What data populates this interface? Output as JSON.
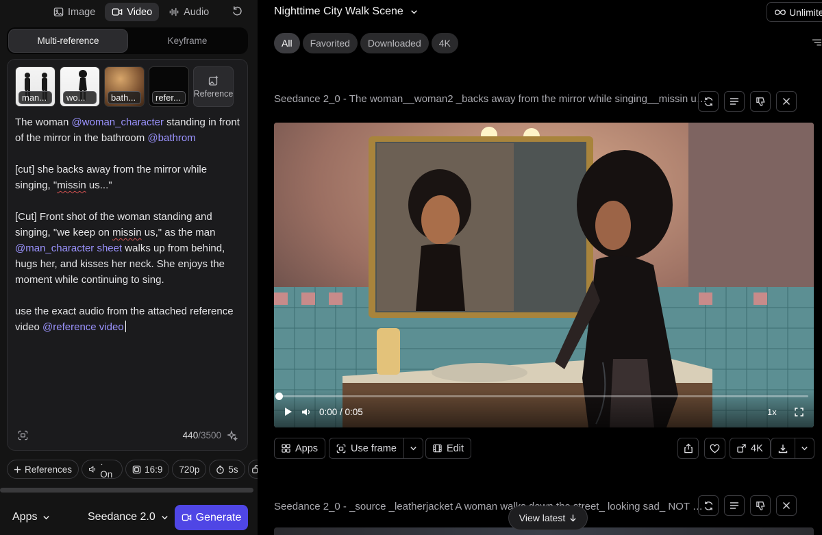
{
  "modes": [
    {
      "label": "Image",
      "icon": "image-icon"
    },
    {
      "label": "Video",
      "icon": "video-icon",
      "active": true
    },
    {
      "label": "Audio",
      "icon": "waveform-icon"
    }
  ],
  "tabs": {
    "multi": "Multi-reference",
    "keyframe": "Keyframe"
  },
  "references": [
    {
      "label": "man..."
    },
    {
      "label": "wo..."
    },
    {
      "label": "bath..."
    },
    {
      "label": "refer..."
    }
  ],
  "add_reference_label": "Reference",
  "prompt": {
    "p1_a": "The woman ",
    "p1_m1": "@woman_character",
    "p1_b": " standing in front of the mirror in the bathroom ",
    "p1_m2": "@bathrom",
    "p2_a": "[cut] she backs away from the mirror while singing, \"",
    "p2_sq": "missin",
    "p2_b": " us...\"",
    "p3_a": "[Cut] Front shot of the woman standing and singing, \"we keep on ",
    "p3_sq": "missin",
    "p3_b": " us,\" as the man ",
    "p3_m1": "@man_character sheet",
    "p3_c": "  walks up from behind, hugs her, and kisses her neck. She enjoys the moment while continuing to sing.",
    "p4_a": "use the exact audio from the attached reference video ",
    "p4_m1": "@reference video"
  },
  "char_count": {
    "current": "440",
    "max": "/3500"
  },
  "settings": {
    "references": "References",
    "audio": "· On",
    "aspect": "16:9",
    "resolution": "720p",
    "duration": "5s"
  },
  "bottom": {
    "apps": "Apps",
    "model": "Seedance 2.0",
    "generate": "Generate"
  },
  "header": {
    "scene_title": "Nighttime City Walk Scene",
    "plan": "Unlimite"
  },
  "filters": [
    "All",
    "Favorited",
    "Downloaded",
    "4K"
  ],
  "generations": [
    {
      "title": "Seedance 2_0 - The woman__woman2 _backs away from the mirror while singing__missin us...",
      "time": "0:00 / 0:05",
      "speed": "1x",
      "progress": 0.0
    },
    {
      "title": "Seedance 2_0 - _source _leatherjacket A woman walks down the street_ looking sad_ NOT R..."
    }
  ],
  "actions": {
    "apps": "Apps",
    "use_frame": "Use frame",
    "edit": "Edit",
    "res": "4K"
  },
  "view_latest": "View latest",
  "colors": {
    "accent": "#4f46e5",
    "mention": "#9b93ff",
    "panel": "#141414"
  }
}
